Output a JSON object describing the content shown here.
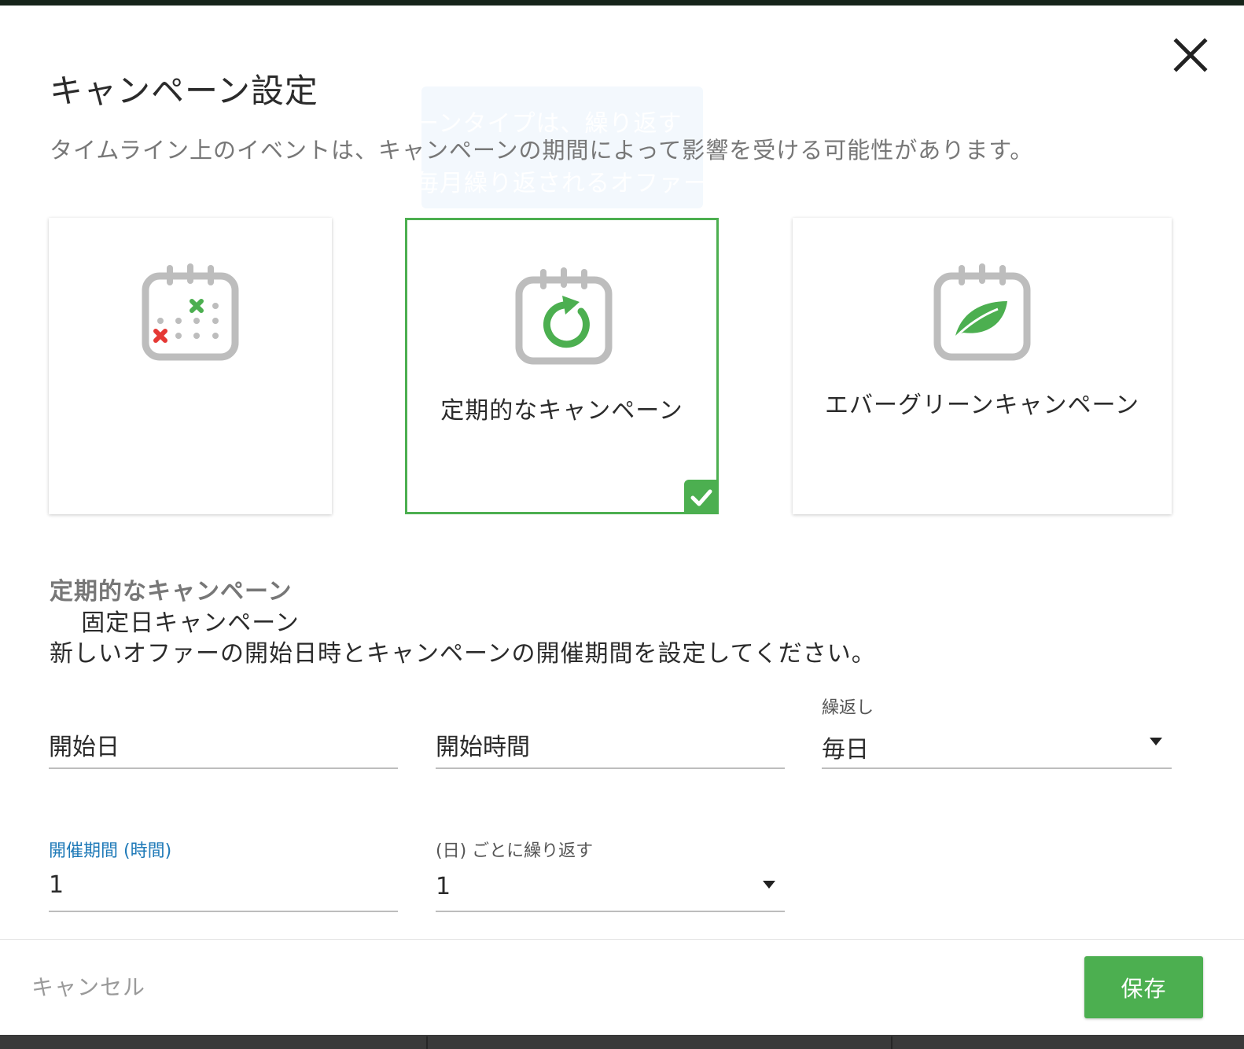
{
  "dialog": {
    "title": "キャンペーン設定",
    "subtitle": "タイムライン上のイベントは、キャンペーンの期間によって影響を受ける可能性があります。",
    "close_icon": "close-icon"
  },
  "tooltip": {
    "line1": "ーンタイプは、繰り返す",
    "line2": "毎月繰り返されるオファー"
  },
  "campaign_types": [
    {
      "label": "固定日キャンペーン",
      "icon": "calendar-fixed-date-icon",
      "selected": false
    },
    {
      "label": "定期的なキャンペーン",
      "icon": "calendar-recurring-icon",
      "selected": true
    },
    {
      "label": "エバーグリーンキャンペーン",
      "icon": "calendar-leaf-icon",
      "selected": false
    }
  ],
  "section": {
    "title": "定期的なキャンペーン",
    "instructions": "新しいオファーの開始日時とキャンペーンの開催期間を設定してください。"
  },
  "fields": {
    "start_date": {
      "placeholder": "開始日"
    },
    "start_time": {
      "placeholder": "開始時間"
    },
    "repeat": {
      "label": "繰返し",
      "value": "毎日"
    },
    "duration": {
      "label": "開催期間 (時間)",
      "value": "1"
    },
    "every": {
      "label": "(日) ごとに繰り返す",
      "value": "1"
    }
  },
  "footer": {
    "cancel_label": "キャンセル",
    "save_label": "保存"
  },
  "colors": {
    "accent_green": "#4caf50",
    "focus_blue": "#1f7ab8",
    "error_red": "#e53935"
  }
}
